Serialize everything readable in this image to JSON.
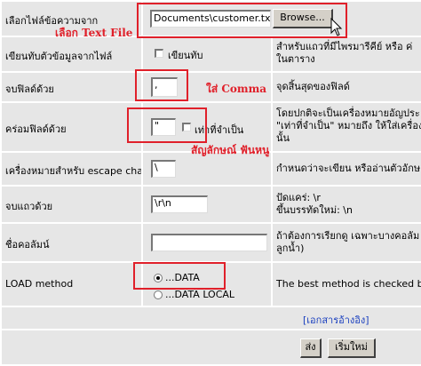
{
  "file_row": {
    "label": "เลือกไฟล์ข้อความจาก",
    "file_value": "Documents\\customer.txt",
    "browse_label": "Browse..."
  },
  "replace_row": {
    "label": "เขียนทับตัวข้อมูลจากไฟล์",
    "checkbox_label": "เขียนทับ",
    "desc_lines": [
      "สำหรับแถวที่มีไพรมารีคีย์ หรือ ค่",
      "ในตาราง"
    ]
  },
  "terminated_row": {
    "label": "จบฟิลด์ด้วย",
    "value": ",",
    "desc": "จุดสิ้นสุดของฟิลด์"
  },
  "enclosed_row": {
    "label": "คร่อมฟิลด์ด้วย",
    "value": "\"",
    "optional_label": "เท่าที่จำเป็น",
    "desc_lines": [
      "โดยปกติจะเป็นเครื่องหมายอัญประ",
      "\"เท่าที่จำเป็น\" หมายถึง ให้ใส่เครื่อง",
      "นั้น"
    ]
  },
  "escaped_row": {
    "label": "เครื่องหมายสำหรับ escape char",
    "value": "\\",
    "desc": "กำหนดว่าจะเขียน หรืออ่านตัวอักษ"
  },
  "lines_row": {
    "label": "จบแถวด้วย",
    "value": "\\r\\n",
    "desc_lines": [
      "ปัดแคร่: \\r",
      "ขึ้นบรรทัดใหม่: \\n"
    ]
  },
  "columns_row": {
    "label": "ชื่อคอลัมน์",
    "value": "",
    "desc_lines": [
      "ถ้าต้องการเรียกดู เฉพาะบางคอลัม",
      "ลูกน้ำ)"
    ]
  },
  "load_row": {
    "label": "LOAD method",
    "option1": "...DATA",
    "option2": "...DATA LOCAL",
    "selected": "...DATA",
    "desc": "The best method is checked by"
  },
  "docs_link": "[เอกสารอ้างอิง]",
  "submit_label": "ส่ง",
  "reset_label": "เริ่มใหม่",
  "annotations": {
    "choose_file": "เลือก Text File",
    "insert_comma": "ใส่ Comma",
    "double_quote": "สัญลักษณ์ ฟันหนู"
  },
  "colors": {
    "annotation_red": "#e0202a",
    "cell_gray": "#e6e6e6",
    "link_blue": "#1a3fbf"
  }
}
